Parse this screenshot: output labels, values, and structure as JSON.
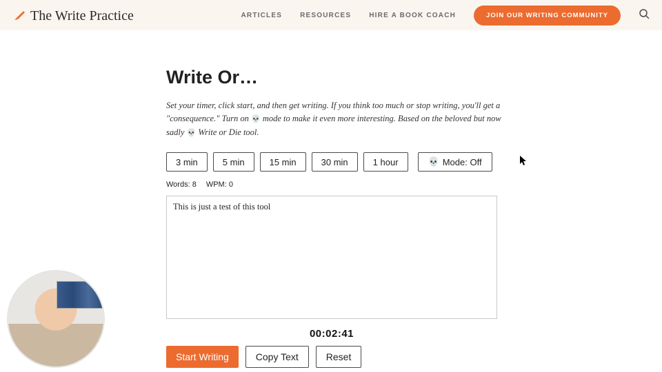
{
  "brand": {
    "name": "The Write Practice"
  },
  "nav": {
    "articles": "ARTICLES",
    "resources": "RESOURCES",
    "hire": "HIRE A BOOK COACH",
    "cta": "JOIN OUR WRITING COMMUNITY"
  },
  "page": {
    "title": "Write Or…",
    "description_a": "Set your timer, click start, and then get writing. If you think too much or stop writing, you'll get a \"consequence.\" Turn on ",
    "description_b": " mode to make it even more interesting. Based on the beloved but now sadly ",
    "description_c": " Write or Die tool.",
    "skull_glyph": "💀"
  },
  "presets": {
    "p3": "3 min",
    "p5": "5 min",
    "p15": "15 min",
    "p30": "30 min",
    "p60": "1 hour"
  },
  "mode": {
    "skull": "💀",
    "label": "Mode: Off"
  },
  "stats": {
    "words_label": "Words:",
    "words_value": "8",
    "wpm_label": "WPM:",
    "wpm_value": "0"
  },
  "editor": {
    "text": "This is just a test of this tool"
  },
  "timer": "00:02:41",
  "actions": {
    "start": "Start Writing",
    "copy": "Copy Text",
    "reset": "Reset"
  }
}
